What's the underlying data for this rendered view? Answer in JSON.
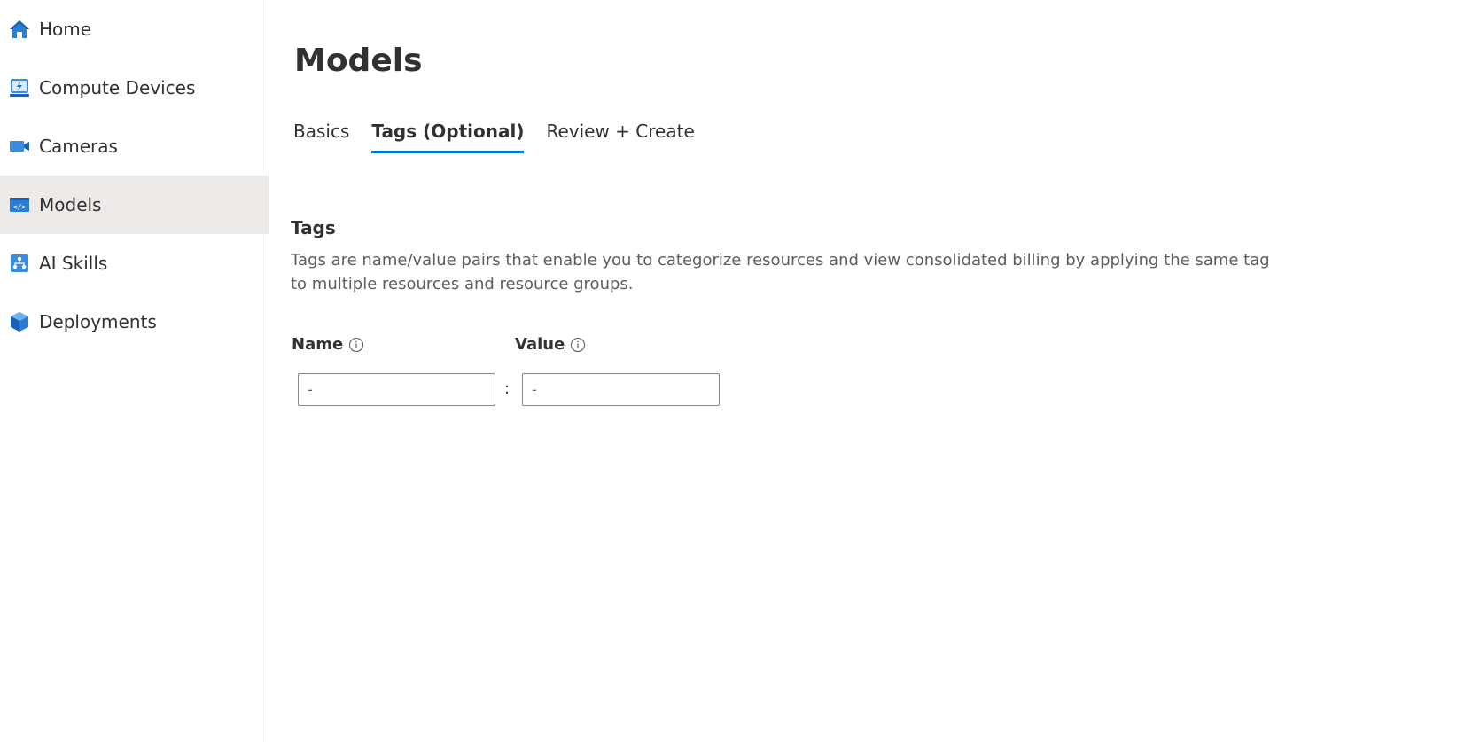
{
  "sidebar": {
    "items": [
      {
        "label": "Home",
        "icon": "home-icon"
      },
      {
        "label": "Compute Devices",
        "icon": "compute-device-icon"
      },
      {
        "label": "Cameras",
        "icon": "camera-icon"
      },
      {
        "label": "Models",
        "icon": "model-icon",
        "active": true
      },
      {
        "label": "AI Skills",
        "icon": "ai-skills-icon"
      },
      {
        "label": "Deployments",
        "icon": "deployment-icon"
      }
    ]
  },
  "main": {
    "title": "Models",
    "tabs": [
      {
        "label": "Basics"
      },
      {
        "label": "Tags (Optional)",
        "selected": true
      },
      {
        "label": "Review + Create"
      }
    ],
    "section": {
      "title": "Tags",
      "description": "Tags are name/value pairs that enable you to categorize resources and view consolidated billing by applying the same tag to multiple resources and resource groups."
    },
    "fields": {
      "name_label": "Name",
      "value_label": "Value",
      "name_placeholder": "-",
      "value_placeholder": "-",
      "separator": ":"
    }
  },
  "colors": {
    "accent": "#0078d4",
    "active_nav_bg": "#edebe9",
    "text": "#323130",
    "muted_text": "#605e5c"
  }
}
